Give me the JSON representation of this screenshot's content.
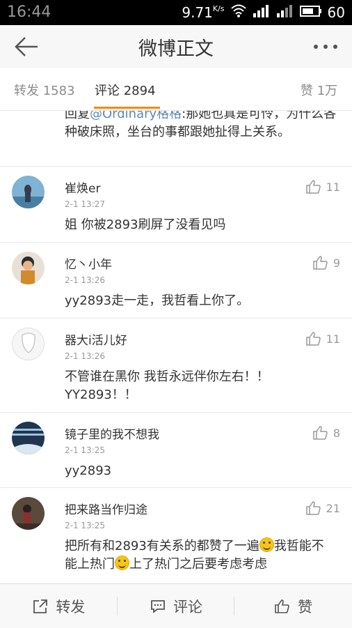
{
  "status_bar": {
    "time": "16:44",
    "network_speed": "9.71",
    "network_unit": "K/s",
    "battery": "60",
    "icons": [
      "wifi-icon",
      "signal-icon",
      "battery-icon"
    ]
  },
  "header": {
    "title": "微博正文",
    "back_icon": "back-arrow-icon",
    "more_icon": "more-dots-icon"
  },
  "tabs": {
    "repost": "转发 1583",
    "comment": "评论 2894",
    "like": "赞 1万",
    "active_color": "#ff8200"
  },
  "partial_comment": {
    "prefix": "回复",
    "mention": "@Ordinary格格",
    "text": ":那她也真是可怜，为什么各种破床照，坐台的事都跟她扯得上关系。"
  },
  "comments": [
    {
      "user": "崔焕er",
      "time": "2-1 13:27",
      "text": "姐 你被2893刷屏了没看见吗",
      "likes": "11"
    },
    {
      "user": "忆丶小年",
      "time": "2-1 13:26",
      "text": "yy2893走一走，我哲看上你了。",
      "likes": "9"
    },
    {
      "user": "器大i活儿好",
      "time": "2-1 13:26",
      "text": "不管谁在黑你  我哲永远伴你左右！！YY2893！！",
      "likes": "11"
    },
    {
      "user": "镜子里的我不想我",
      "time": "2-1 13:25",
      "text": "yy2893",
      "likes": "8"
    },
    {
      "user": "把来路当作归途",
      "time": "2-1 13:25",
      "text_parts": [
        "把所有和2893有关系的都赞了一遍",
        "我哲能不能上热门",
        "上了热门之后要考虑考虑"
      ],
      "likes": "21"
    }
  ],
  "bottom_bar": {
    "repost": "转发",
    "comment": "评论",
    "like": "赞"
  }
}
